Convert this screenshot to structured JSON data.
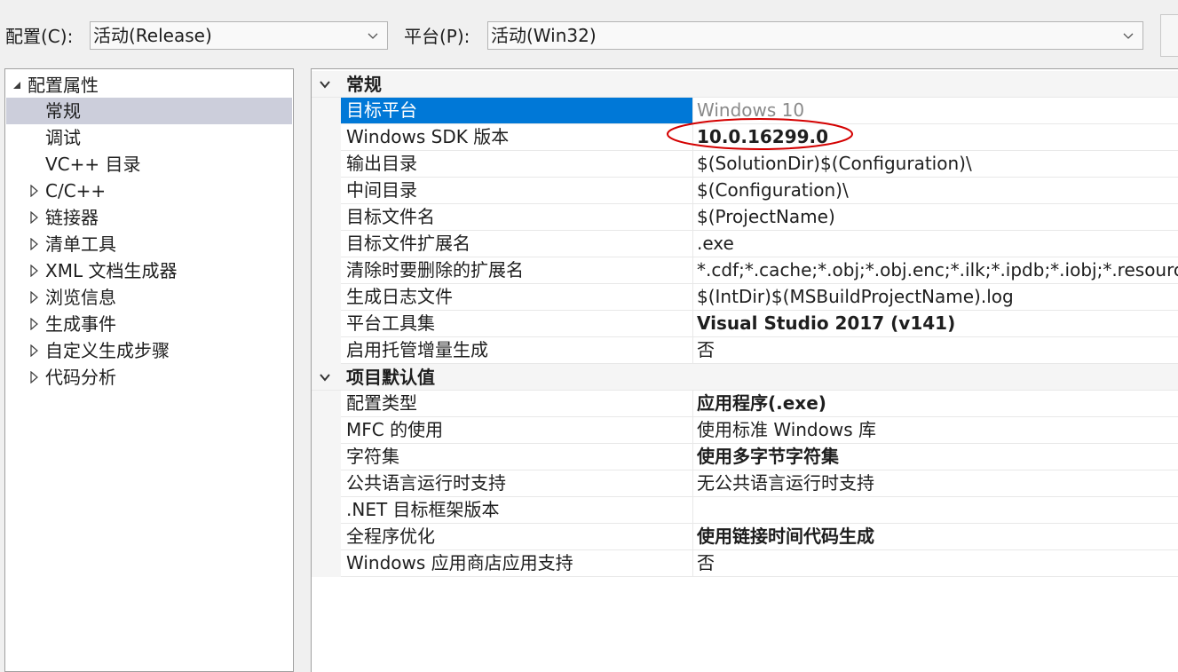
{
  "toolbar": {
    "config_label": "配置(C):",
    "config_value": "活动(Release)",
    "platform_label": "平台(P):",
    "platform_value": "活动(Win32)"
  },
  "tree": {
    "root": "配置属性",
    "items": [
      {
        "label": "常规",
        "selected": true,
        "expandable": false
      },
      {
        "label": "调试",
        "selected": false,
        "expandable": false
      },
      {
        "label": "VC++ 目录",
        "selected": false,
        "expandable": false
      },
      {
        "label": "C/C++",
        "selected": false,
        "expandable": true
      },
      {
        "label": "链接器",
        "selected": false,
        "expandable": true
      },
      {
        "label": "清单工具",
        "selected": false,
        "expandable": true
      },
      {
        "label": "XML 文档生成器",
        "selected": false,
        "expandable": true
      },
      {
        "label": "浏览信息",
        "selected": false,
        "expandable": true
      },
      {
        "label": "生成事件",
        "selected": false,
        "expandable": true
      },
      {
        "label": "自定义生成步骤",
        "selected": false,
        "expandable": true
      },
      {
        "label": "代码分析",
        "selected": false,
        "expandable": true
      }
    ]
  },
  "grid": {
    "categories": [
      {
        "title": "常规",
        "rows": [
          {
            "name": "目标平台",
            "value": "Windows 10",
            "style": "gray",
            "selected": true
          },
          {
            "name": "Windows SDK 版本",
            "value": "10.0.16299.0",
            "style": "bold",
            "selected": false
          },
          {
            "name": "输出目录",
            "value": "$(SolutionDir)$(Configuration)\\",
            "style": "normal",
            "selected": false
          },
          {
            "name": "中间目录",
            "value": "$(Configuration)\\",
            "style": "normal",
            "selected": false
          },
          {
            "name": "目标文件名",
            "value": "$(ProjectName)",
            "style": "normal",
            "selected": false
          },
          {
            "name": "目标文件扩展名",
            "value": ".exe",
            "style": "normal",
            "selected": false
          },
          {
            "name": "清除时要删除的扩展名",
            "value": "*.cdf;*.cache;*.obj;*.obj.enc;*.ilk;*.ipdb;*.iobj;*.resources",
            "style": "normal",
            "selected": false
          },
          {
            "name": "生成日志文件",
            "value": "$(IntDir)$(MSBuildProjectName).log",
            "style": "normal",
            "selected": false
          },
          {
            "name": "平台工具集",
            "value": "Visual Studio 2017 (v141)",
            "style": "bold",
            "selected": false
          },
          {
            "name": "启用托管增量生成",
            "value": "否",
            "style": "normal",
            "selected": false
          }
        ]
      },
      {
        "title": "项目默认值",
        "rows": [
          {
            "name": "配置类型",
            "value": "应用程序(.exe)",
            "style": "bold",
            "selected": false
          },
          {
            "name": "MFC 的使用",
            "value": "使用标准 Windows 库",
            "style": "normal",
            "selected": false
          },
          {
            "name": "字符集",
            "value": "使用多字节字符集",
            "style": "bold",
            "selected": false
          },
          {
            "name": "公共语言运行时支持",
            "value": "无公共语言运行时支持",
            "style": "normal",
            "selected": false
          },
          {
            "name": ".NET 目标框架版本",
            "value": "",
            "style": "normal",
            "selected": false
          },
          {
            "name": "全程序优化",
            "value": "使用链接时间代码生成",
            "style": "bold",
            "selected": false
          },
          {
            "name": "Windows 应用商店应用支持",
            "value": "否",
            "style": "normal",
            "selected": false
          }
        ]
      }
    ]
  },
  "colors": {
    "selection": "#0078d7",
    "tree_selection": "#cccedb",
    "annotation": "#d40000"
  },
  "icons": {
    "combo_arrow": "chevron-down-icon",
    "tree_root": "triangle-expanded-icon",
    "tree_collapsed": "triangle-collapsed-icon",
    "category": "chevron-down-icon"
  }
}
